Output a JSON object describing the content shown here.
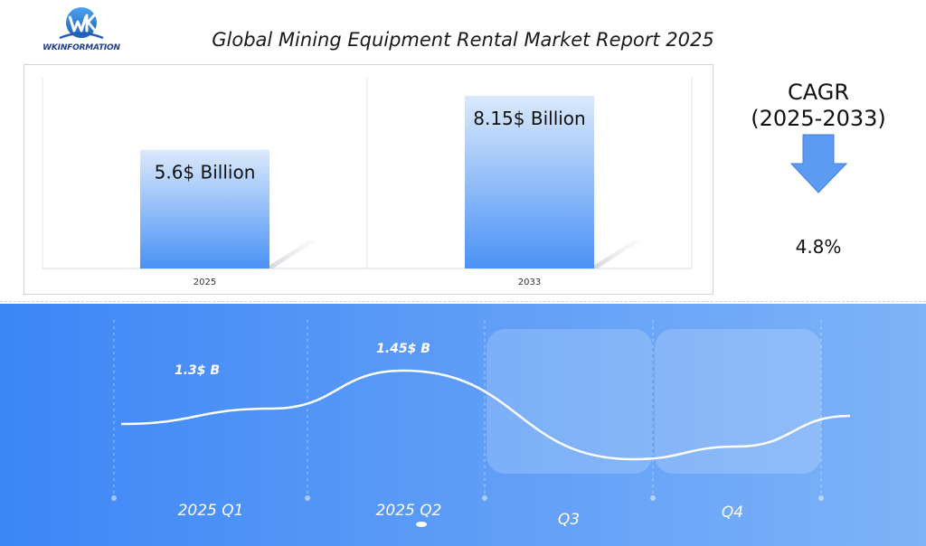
{
  "header": {
    "logo_text": "WKINFORMATION",
    "title": "Global Mining Equipment Rental Market Report 2025"
  },
  "cagr": {
    "label_line1": "CAGR",
    "label_line2": "(2025-2033)",
    "value": "4.8%",
    "arrow_icon": "down-arrow-icon"
  },
  "colors": {
    "bar_top": "#dbe9fb",
    "bar_bottom": "#4a92f6",
    "arrow": "#5b9cf2",
    "band_left": "#3c86f6",
    "band_right": "#7fb3f8"
  },
  "chart_data": [
    {
      "type": "bar",
      "categories": [
        "2025",
        "2033"
      ],
      "values": [
        5.6,
        8.15
      ],
      "data_labels": [
        "5.6$ Billion",
        "8.15$ Billion"
      ],
      "ylim": [
        0,
        9
      ],
      "grid": false
    },
    {
      "type": "line",
      "categories": [
        "2025 Q1",
        "2025 Q2",
        "Q3",
        "Q4"
      ],
      "values": [
        1.3,
        1.45,
        1.1,
        1.15
      ],
      "data_labels": [
        "1.3$ B",
        "1.45$ B",
        "",
        ""
      ]
    }
  ]
}
